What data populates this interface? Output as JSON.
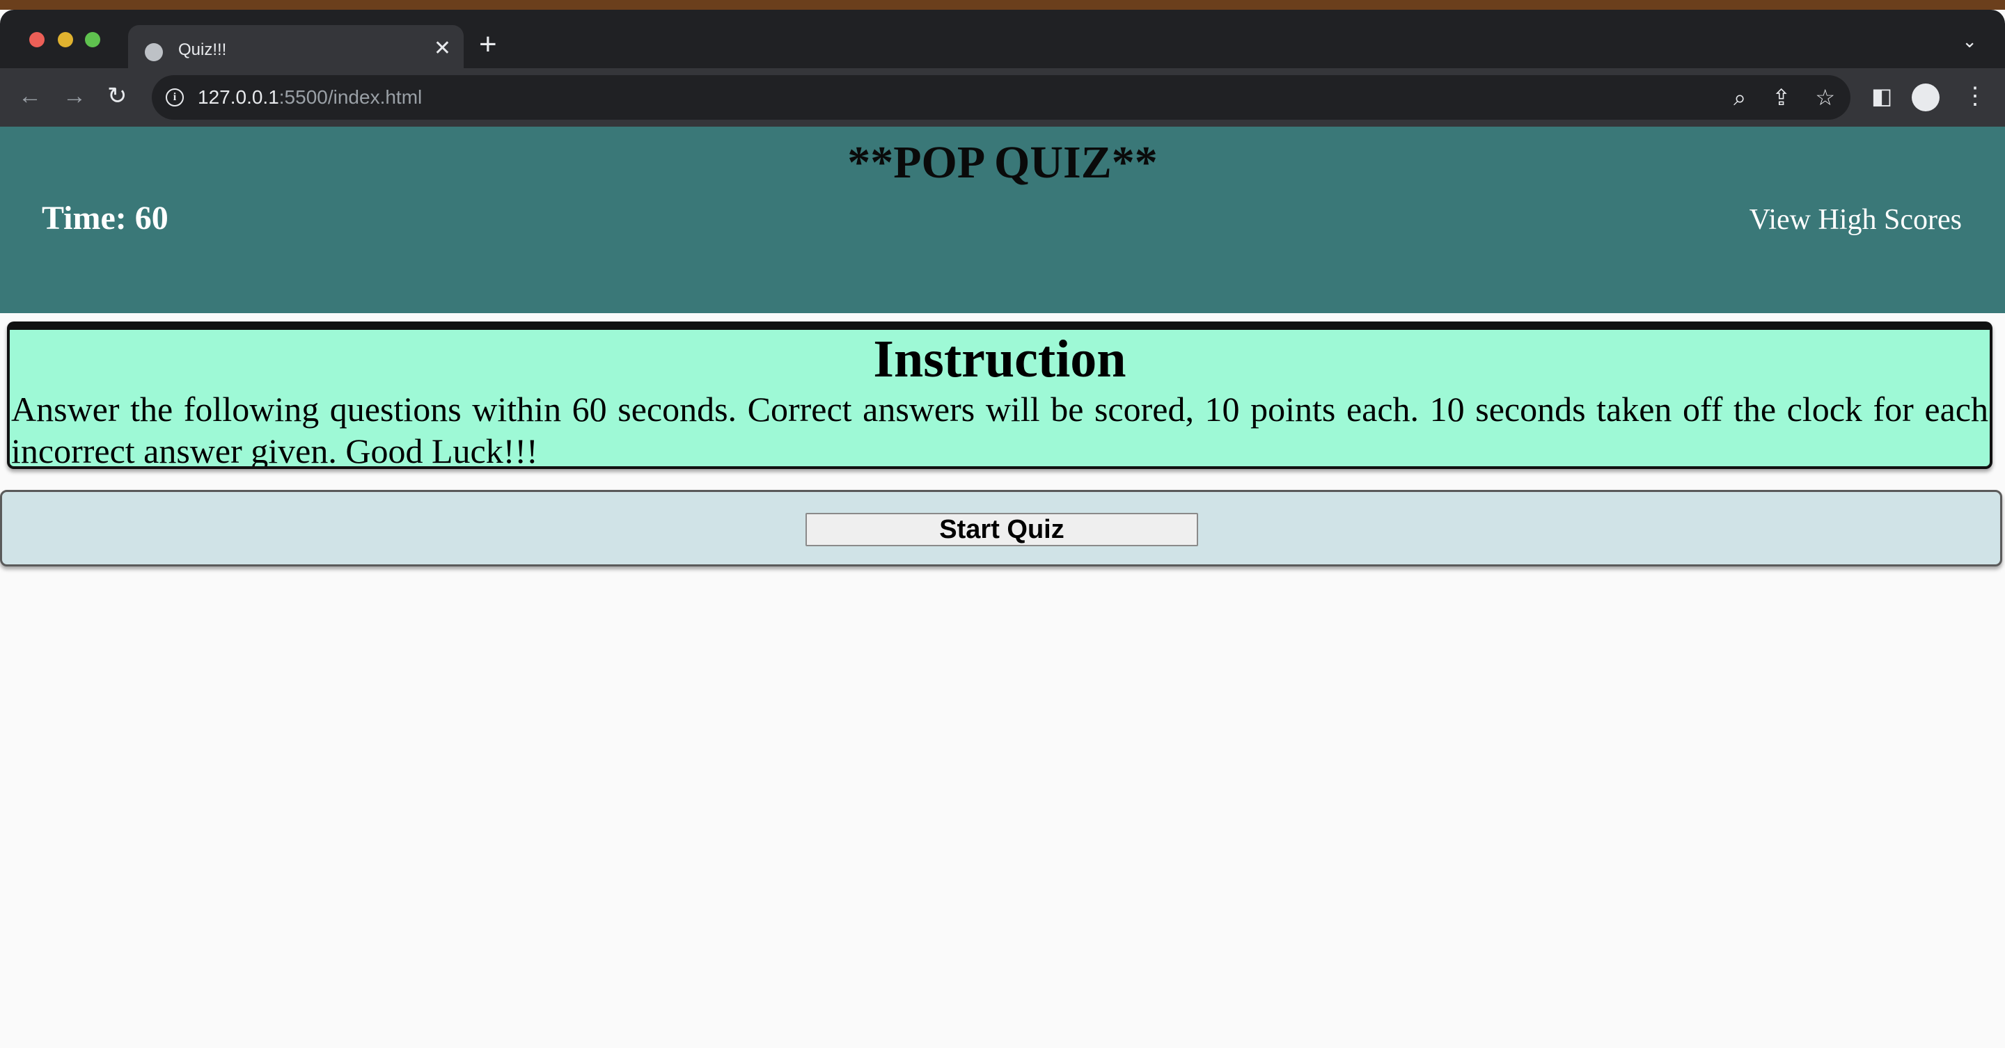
{
  "browser": {
    "tab_title": "Quiz!!!",
    "tab_close": "✕",
    "new_tab": "+",
    "tab_menu": "⌄",
    "url_host": "127.0.0.1",
    "url_rest": ":5500/index.html",
    "icons": {
      "back": "←",
      "forward": "→",
      "reload": "↻",
      "zoom": "⌕",
      "share": "⇪",
      "star": "☆",
      "side_panel": "◧",
      "menu": "⋮"
    }
  },
  "header": {
    "title": "**POP QUIZ**",
    "timer": "Time: 60",
    "high_scores_link": "View High Scores",
    "background_color": "#3a7878"
  },
  "instructions": {
    "heading": "Instruction",
    "text": "Answer the following questions within 60 seconds. Correct answers will be scored, 10 points each. 10 seconds taken off the clock for each incorrect answer given. Good Luck!!!",
    "background_color": "#9ef9d6"
  },
  "start": {
    "button_label": "Start Quiz",
    "background_color": "#d0e3e7"
  }
}
